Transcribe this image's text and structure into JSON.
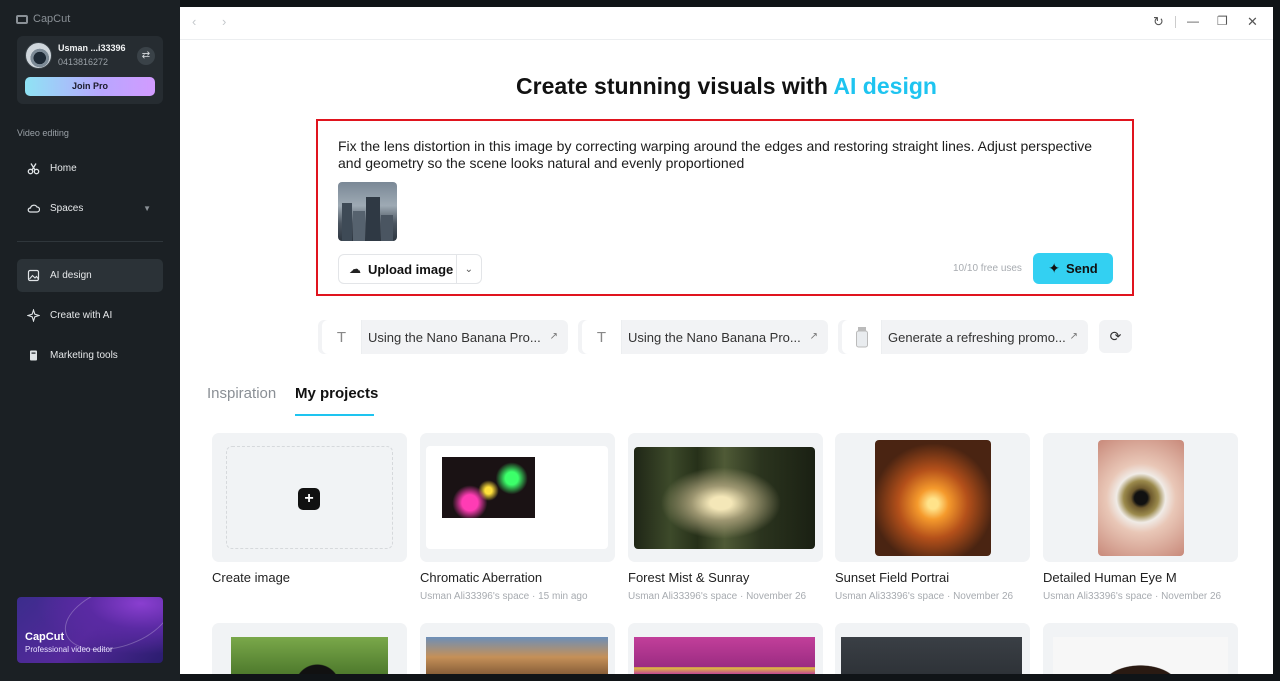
{
  "app": {
    "brand": "CapCut"
  },
  "user": {
    "name": "Usman ...i33396",
    "id": "0413816272",
    "join_label": "Join Pro"
  },
  "sidebar": {
    "section_label": "Video editing",
    "items": [
      {
        "label": "Home",
        "icon": "home-icon"
      },
      {
        "label": "Spaces",
        "icon": "cloud-icon"
      },
      {
        "label": "AI design",
        "icon": "image-icon"
      },
      {
        "label": "Create with AI",
        "icon": "sparkle-icon"
      },
      {
        "label": "Marketing tools",
        "icon": "marketing-icon"
      }
    ],
    "promo": {
      "title": "CapCut",
      "subtitle": "Professional video editor"
    }
  },
  "headline": {
    "prefix": "Create stunning visuals with ",
    "accent": "AI design"
  },
  "prompt": {
    "text": "Fix the lens distortion in this image by correcting warping around the edges and restoring straight lines. Adjust perspective and geometry so the scene looks natural and evenly proportioned",
    "upload_label": "Upload image",
    "free_uses": "10/10 free uses",
    "send_label": "Send"
  },
  "suggestions": [
    {
      "text": "Using the Nano Banana Pro..."
    },
    {
      "text": "Using the Nano Banana Pro..."
    },
    {
      "text": "Generate a refreshing promo..."
    }
  ],
  "tabs": [
    {
      "label": "Inspiration"
    },
    {
      "label": "My projects"
    }
  ],
  "projects": [
    {
      "title": "Create image",
      "meta": ""
    },
    {
      "title": "Chromatic Aberration",
      "meta": "Usman Ali33396's space · 15 min ago"
    },
    {
      "title": "Forest Mist & Sunray",
      "meta": "Usman Ali33396's space · November 26"
    },
    {
      "title": "Sunset Field Portrai",
      "meta": "Usman Ali33396's space · November 26"
    },
    {
      "title": "Detailed Human Eye M",
      "meta": "Usman Ali33396's space · November 26"
    }
  ],
  "colors": {
    "accent": "#1ec4f0",
    "send": "#33d0f2",
    "highlight_border": "#e0141e",
    "sidebar_bg": "#1b2024"
  }
}
